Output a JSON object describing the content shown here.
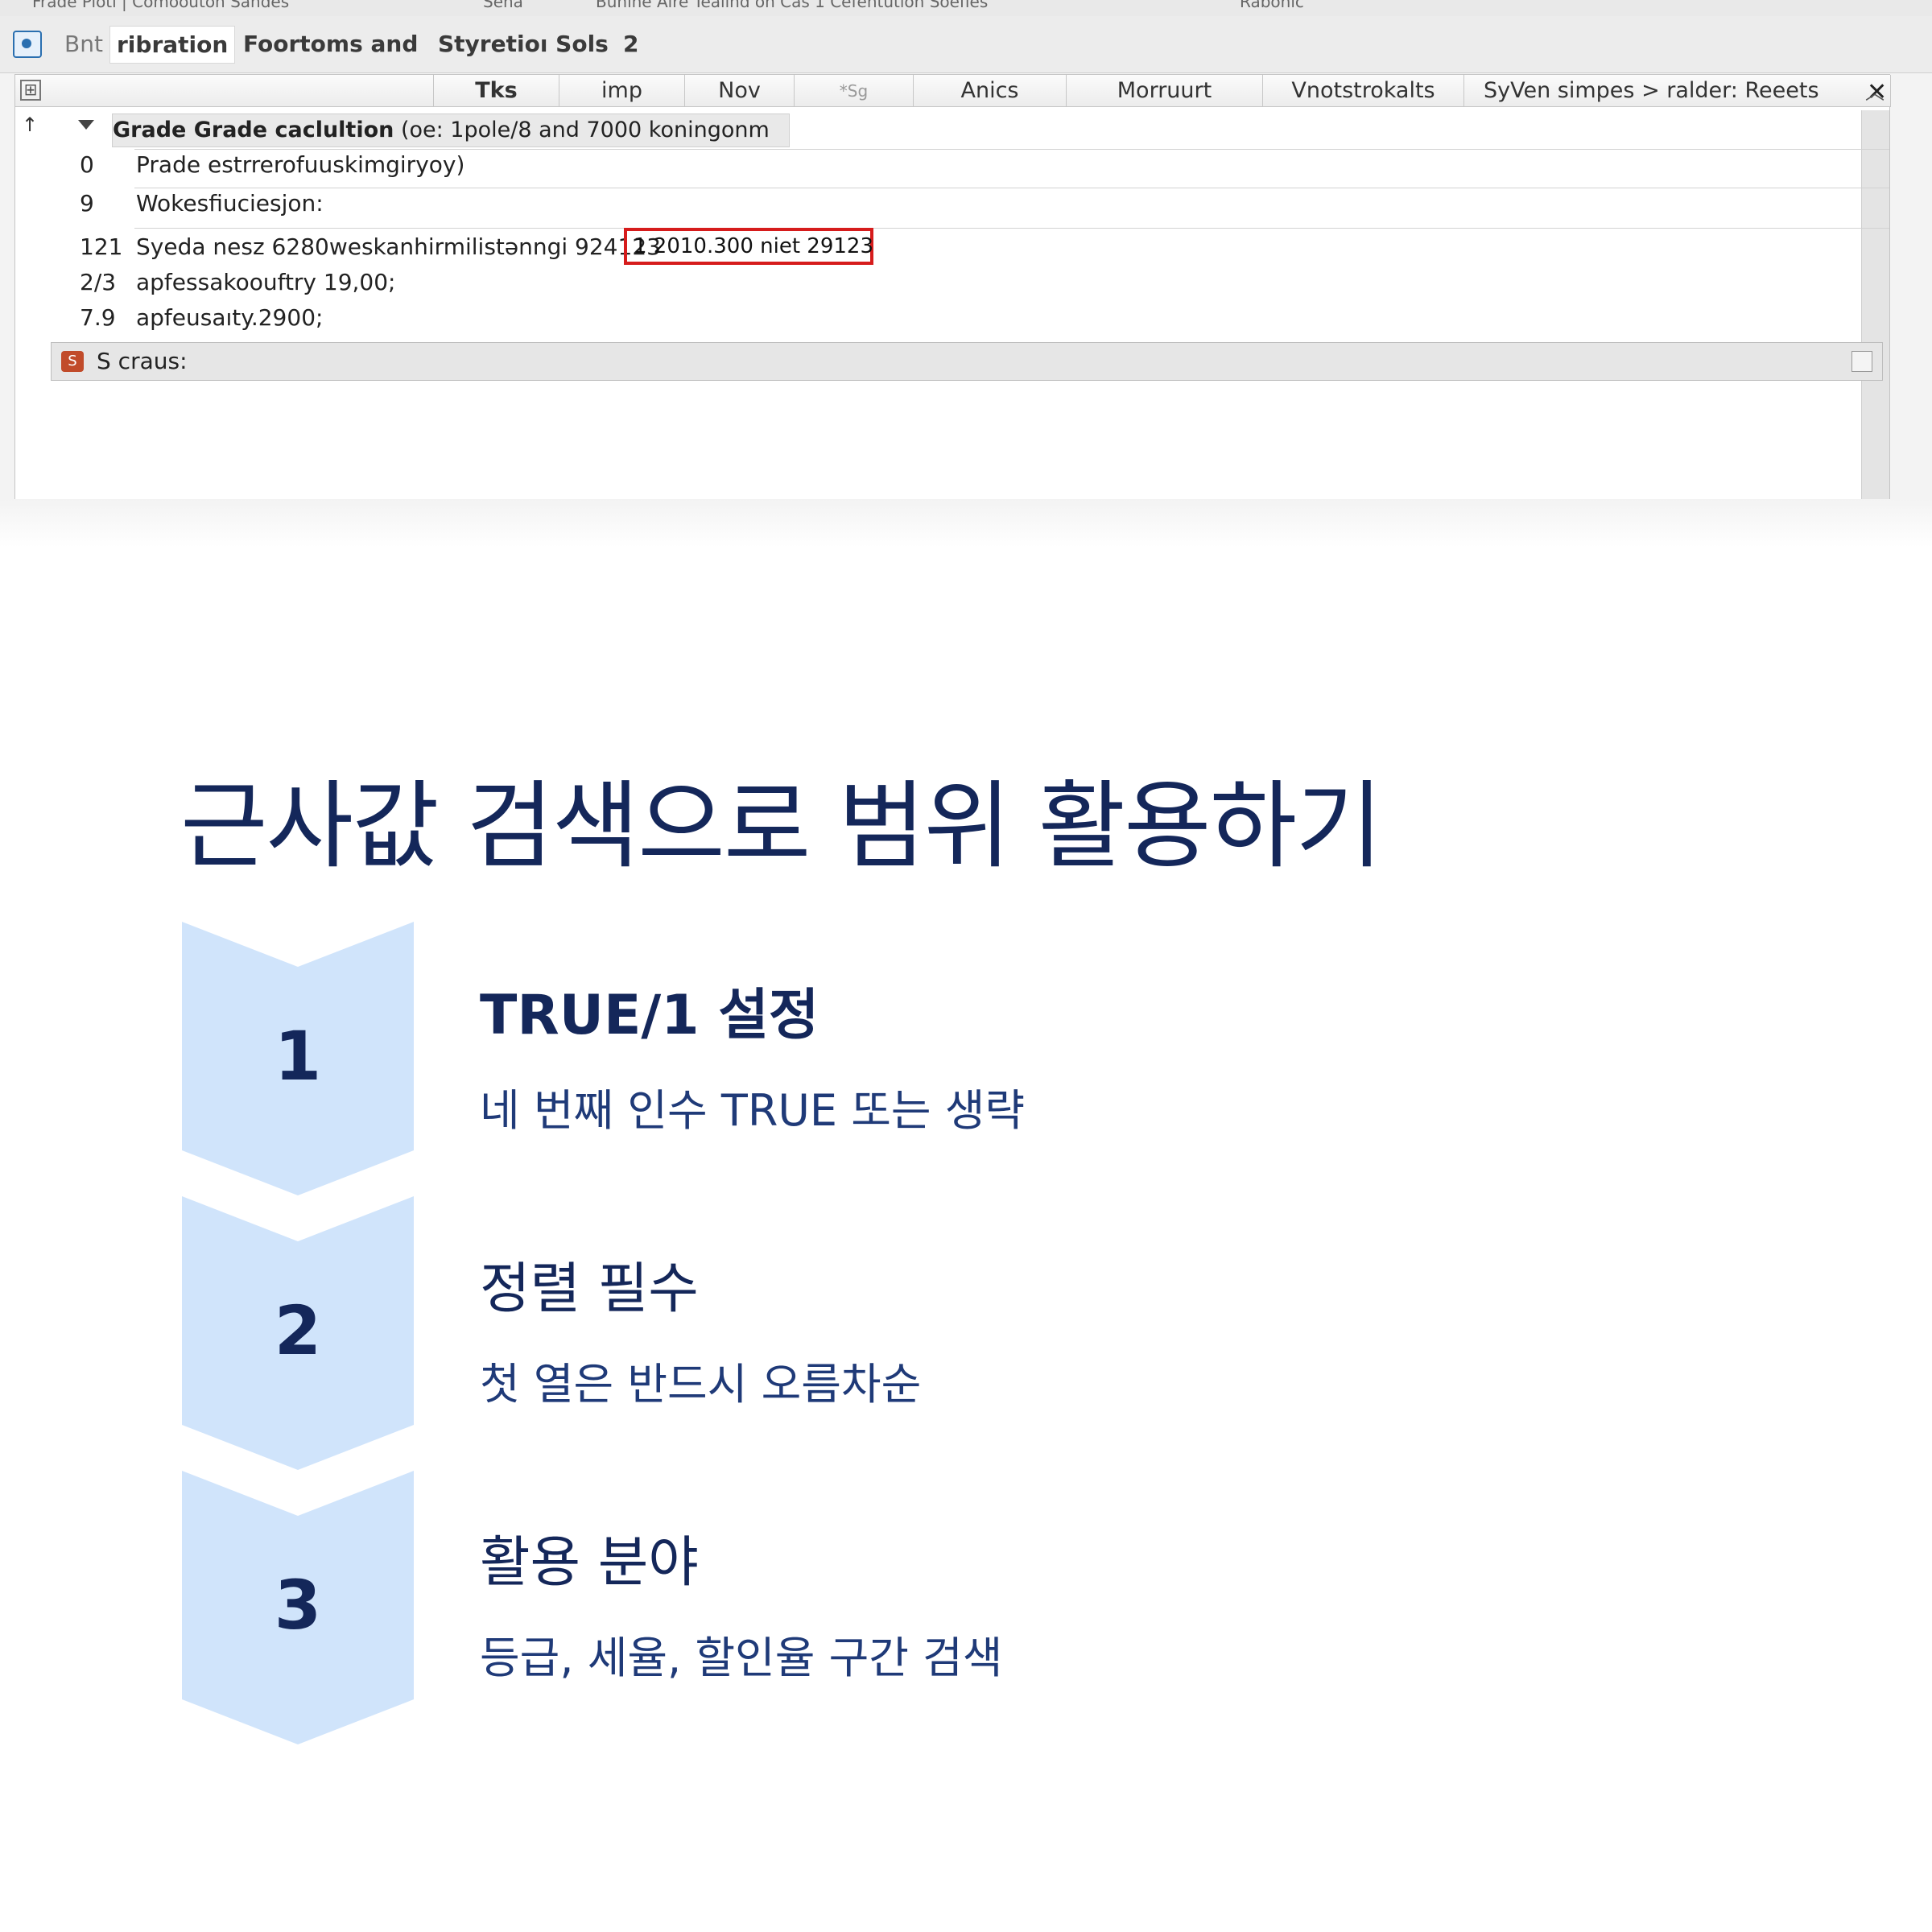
{
  "screenshot": {
    "menubar": [
      "Frade  Pioti | Comoouton   Sandes",
      "Sena",
      "Buhihe Aire Tealind on Cas 1  Cefentution Soefies",
      "Rabonic"
    ],
    "tabs": [
      {
        "label": "Bnt",
        "active": false
      },
      {
        "label": "ribration",
        "active": true
      },
      {
        "label": "Foortoms  and",
        "active": false
      },
      {
        "label": "Styretioı Sols",
        "active": false
      },
      {
        "label": "2",
        "active": false
      }
    ],
    "columns": [
      "Tks",
      "imp",
      "Nov",
      "*Sg",
      "Anics",
      "Morruurt",
      "Vnotstrokalts",
      "SyVen simpes > ralder: Reeets"
    ],
    "group": {
      "bold": "Grade Grade caclultion",
      "rest": " (oe: 1pole/8 and 7000 koningonm"
    },
    "rows": [
      {
        "idx": "0",
        "text": "Prade estrrerofuuskimgiryoy)"
      },
      {
        "idx": "9",
        "text": "Wokesfiuciesjon:"
      },
      {
        "idx": "121",
        "text": "Syeda nesz 6280weskanhirmilistǝnngi 924123",
        "highlight": "1 2010.300 niet 29123"
      },
      {
        "idx": "2/3",
        "text": "apfessakoouftry 19,00;"
      },
      {
        "idx": "7.9",
        "text": "apfeusaıty.2900;"
      }
    ],
    "status_label": "S craus:"
  },
  "slide": {
    "title": "근사값 검색으로 범위 활용하기",
    "accent_color": "#14275a",
    "chevron_color": "#d0e4fb",
    "steps": [
      {
        "num": "1",
        "title": "TRUE/1 설정",
        "desc": "네 번째 인수 TRUE 또는 생략"
      },
      {
        "num": "2",
        "title": "정렬 필수",
        "desc": "첫 열은 반드시 오름차순"
      },
      {
        "num": "3",
        "title": "활용 분야",
        "desc": "등급, 세율, 할인율 구간 검색"
      }
    ]
  }
}
